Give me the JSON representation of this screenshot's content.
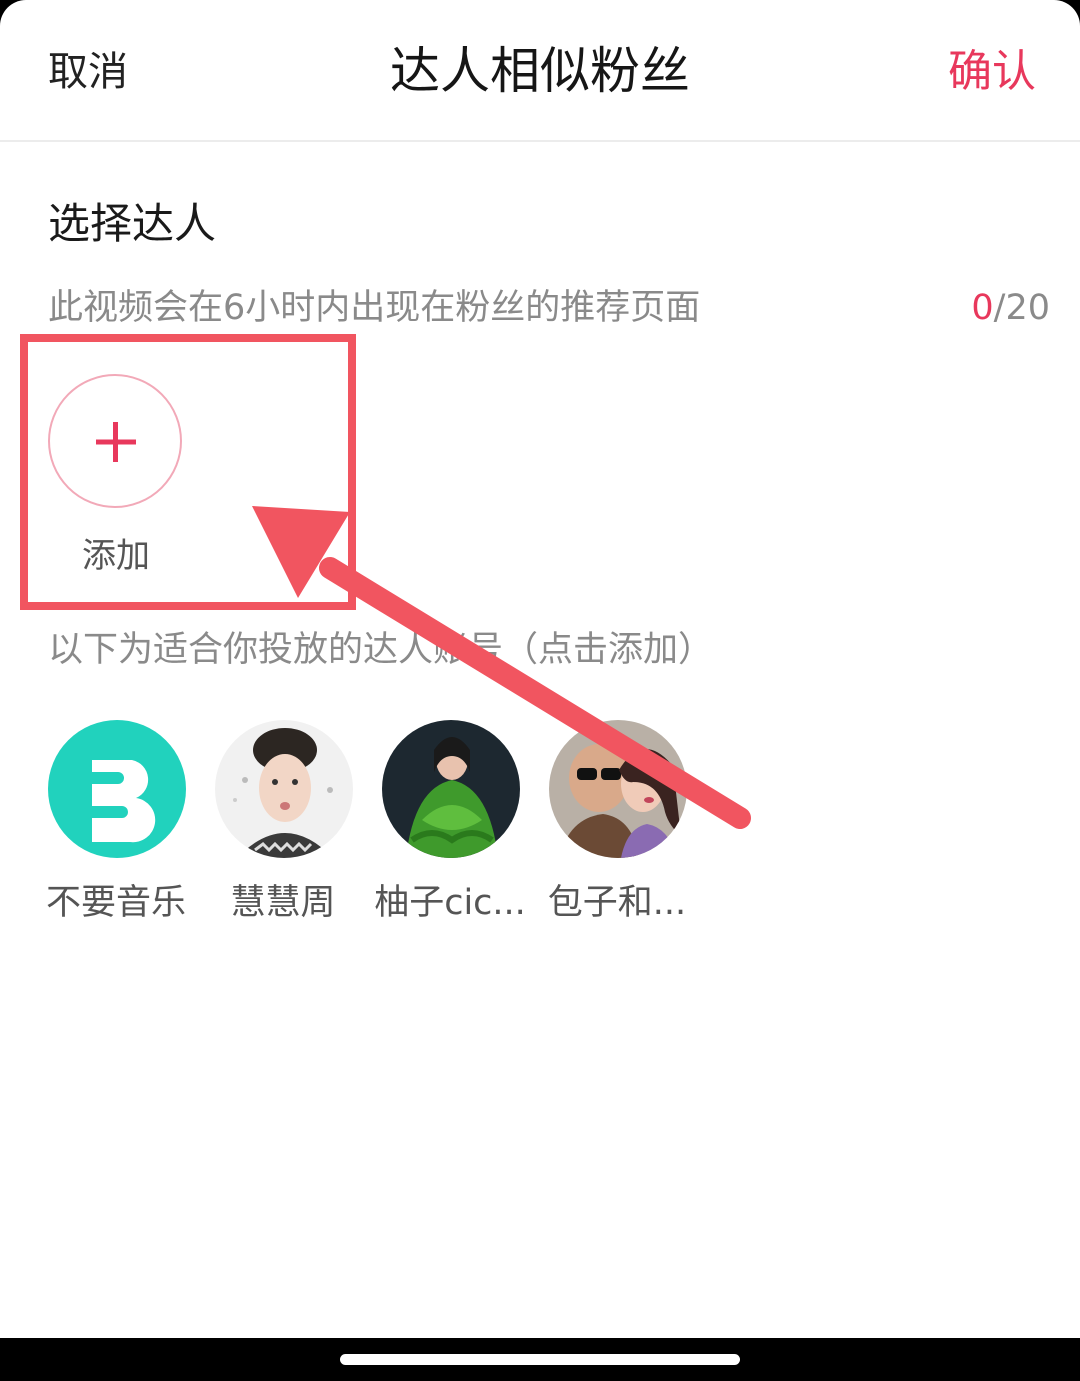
{
  "header": {
    "cancel_label": "取消",
    "title": "达人相似粉丝",
    "confirm_label": "确认"
  },
  "select_section": {
    "title": "选择达人",
    "description": "此视频会在6小时内出现在粉丝的推荐页面",
    "count_current": "0",
    "count_total": "/20",
    "add_label": "添加"
  },
  "recommend_section": {
    "hint": "以下为适合你投放的达人账号（点击添加）",
    "creators": [
      {
        "name": "不要音乐"
      },
      {
        "name": "慧慧周"
      },
      {
        "name": "柚子cic..."
      },
      {
        "name": "包子和..."
      }
    ]
  },
  "colors": {
    "accent": "#e8385c",
    "annotation": "#f15560",
    "logo_teal": "#21d2bd"
  },
  "icons": {
    "add": "plus-icon"
  }
}
